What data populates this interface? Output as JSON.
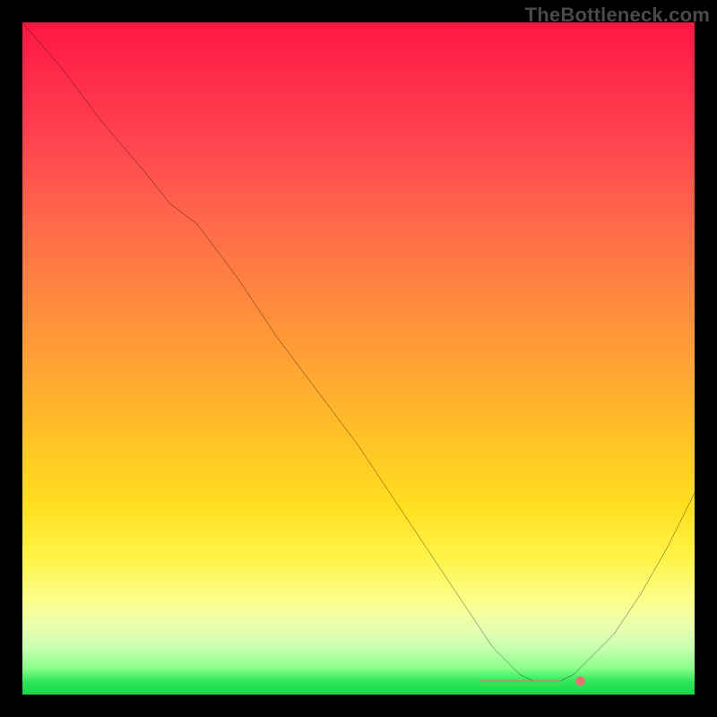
{
  "watermark": "TheBottleneck.com",
  "chart_data": {
    "type": "line",
    "title": "",
    "xlabel": "",
    "ylabel": "",
    "xlim": [
      0,
      100
    ],
    "ylim": [
      0,
      100
    ],
    "grid": false,
    "series": [
      {
        "name": "bottleneck-curve",
        "x": [
          0,
          6,
          12,
          18,
          22,
          26,
          32,
          38,
          44,
          50,
          56,
          62,
          66,
          68,
          70,
          72,
          74,
          76,
          78,
          80,
          82,
          84,
          88,
          92,
          96,
          100
        ],
        "y": [
          100,
          93,
          85,
          78,
          73,
          70,
          62,
          53,
          45,
          37,
          28,
          19,
          13,
          10,
          7,
          5,
          3,
          2,
          2,
          2,
          3,
          5,
          9,
          15,
          22,
          30
        ]
      }
    ],
    "markers": [
      {
        "name": "flat-min-cluster-start",
        "x": 68,
        "y": 2
      },
      {
        "name": "flat-min-cluster-end",
        "x": 80,
        "y": 2
      },
      {
        "name": "flat-min-outlier",
        "x": 83,
        "y": 2
      }
    ],
    "background_gradient": {
      "stops": [
        {
          "pos": 0,
          "color": "#ff1744"
        },
        {
          "pos": 30,
          "color": "#ff6a4a"
        },
        {
          "pos": 60,
          "color": "#ffc227"
        },
        {
          "pos": 85,
          "color": "#fbff8a"
        },
        {
          "pos": 100,
          "color": "#12d848"
        }
      ]
    }
  }
}
